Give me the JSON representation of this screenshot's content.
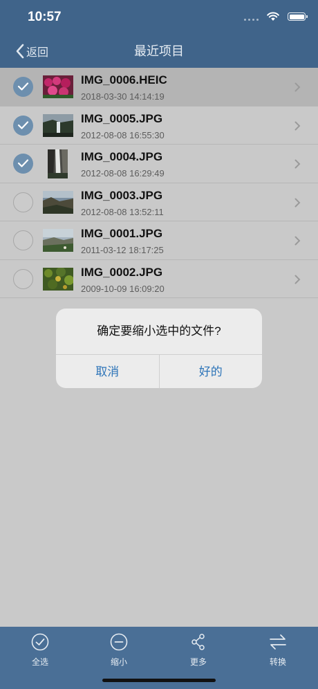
{
  "status": {
    "time": "10:57"
  },
  "nav": {
    "back_label": "返回",
    "title": "最近项目"
  },
  "files": [
    {
      "name": "IMG_0006.HEIC",
      "date": "2018-03-30 14:14:19",
      "selected": true
    },
    {
      "name": "IMG_0005.JPG",
      "date": "2012-08-08 16:55:30",
      "selected": true
    },
    {
      "name": "IMG_0004.JPG",
      "date": "2012-08-08 16:29:49",
      "selected": true
    },
    {
      "name": "IMG_0003.JPG",
      "date": "2012-08-08 13:52:11",
      "selected": false
    },
    {
      "name": "IMG_0001.JPG",
      "date": "2011-03-12 18:17:25",
      "selected": false
    },
    {
      "name": "IMG_0002.JPG",
      "date": "2009-10-09 16:09:20",
      "selected": false
    }
  ],
  "dialog": {
    "message": "确定要缩小选中的文件?",
    "cancel_label": "取消",
    "ok_label": "好的"
  },
  "tabbar": {
    "select_all": "全选",
    "shrink": "缩小",
    "more": "更多",
    "convert": "转换"
  },
  "colors": {
    "header": "#40648a",
    "accent": "#2d74b8",
    "check": "#6d8fae"
  }
}
